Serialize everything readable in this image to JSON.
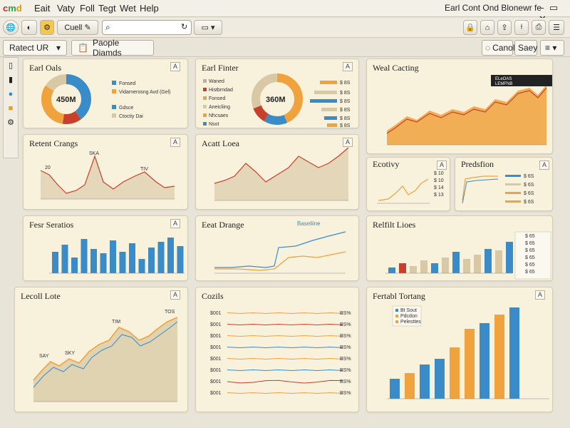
{
  "menubar": {
    "logo": "cmd",
    "items": [
      "Eait",
      "Vaty",
      "Foll",
      "Tegt",
      "Wet",
      "Help"
    ],
    "window_title": "Earl Cont Ond Blonewr fe",
    "controls": "– ▭ ✕"
  },
  "toolbar": {
    "cloud_label": "Cuell",
    "search_value": "",
    "search_placeholder": "",
    "dropdown_label": ""
  },
  "tabbar": {
    "view_select": "Ratect UR",
    "tab_label": "Paople Diamds",
    "cancel_label": "Canol",
    "save_label": "Saey"
  },
  "cards": {
    "c1": {
      "title": "Earl Oals",
      "btn": "A",
      "center": "450M",
      "legend": [
        "Fonsed",
        "Vidarnerosng Avd (Gel)",
        "Gdsce",
        "Ctoctiy Dai"
      ]
    },
    "c2": {
      "title": "Earl Finter",
      "btn": "A",
      "center": "360M",
      "legend": [
        "Waned",
        "Histbrndad",
        "Fonsed",
        "Aneicliing",
        "Nhcsaes",
        "Nsot"
      ],
      "bar_labels": [
        "$ 8S",
        "$ 8S",
        "$ 8S",
        "$ 8S",
        "$ 8S",
        "$ 8S"
      ]
    },
    "c3": {
      "title": "Weal Cacting",
      "tooltip": [
        "ELeOAS",
        "LEMFNB"
      ]
    },
    "c4": {
      "title": "Retent Crangs",
      "btn": "A",
      "labels": [
        "20",
        "SKA",
        "TIV"
      ]
    },
    "c5": {
      "title": "Acatt Loea",
      "btn": "A"
    },
    "c6": {
      "title": "Ecotivy",
      "btn": "A",
      "values": [
        "$ 10",
        "$ 10",
        "$ 14",
        "$ 13"
      ]
    },
    "c7": {
      "title": "Predsfion",
      "btn": "A",
      "values": [
        "$ 6S",
        "$ 6S",
        "$ 6S",
        "$ 6S"
      ]
    },
    "c8": {
      "title": "Fesr Seratios",
      "btn": "A"
    },
    "c9": {
      "title": "Eeat Drange",
      "legend": "Baseliine"
    },
    "c10": {
      "title": "Relfilt Lioes",
      "legend": [
        "$ 65",
        "$ 65",
        "$ 65",
        "$ 65",
        "$ 65",
        "$ 65"
      ]
    },
    "c11": {
      "title": "Lecoll Lote",
      "btn": "A",
      "labels": [
        "SAY",
        "SKY",
        "TIM",
        "TOS"
      ]
    },
    "c12": {
      "title": "Cozils",
      "left_labels": [
        "$001",
        "$001",
        "$001",
        "$001",
        "$001",
        "$001",
        "$001",
        "$001"
      ],
      "right_labels": [
        "BS%",
        "BS%",
        "BS%",
        "BS%",
        "BS%",
        "BS%",
        "BS%",
        "BS%"
      ]
    },
    "c13": {
      "title": "Fertabl Tortang",
      "btn": "A",
      "legend": [
        "Bt Sout",
        "Pdcdon",
        "Pelesttes"
      ]
    }
  },
  "colors": {
    "blue": "#3a8cc8",
    "orange": "#f0a23c",
    "red": "#c8402c",
    "tan": "#d8c8a4",
    "gray": "#b8b0a0"
  }
}
